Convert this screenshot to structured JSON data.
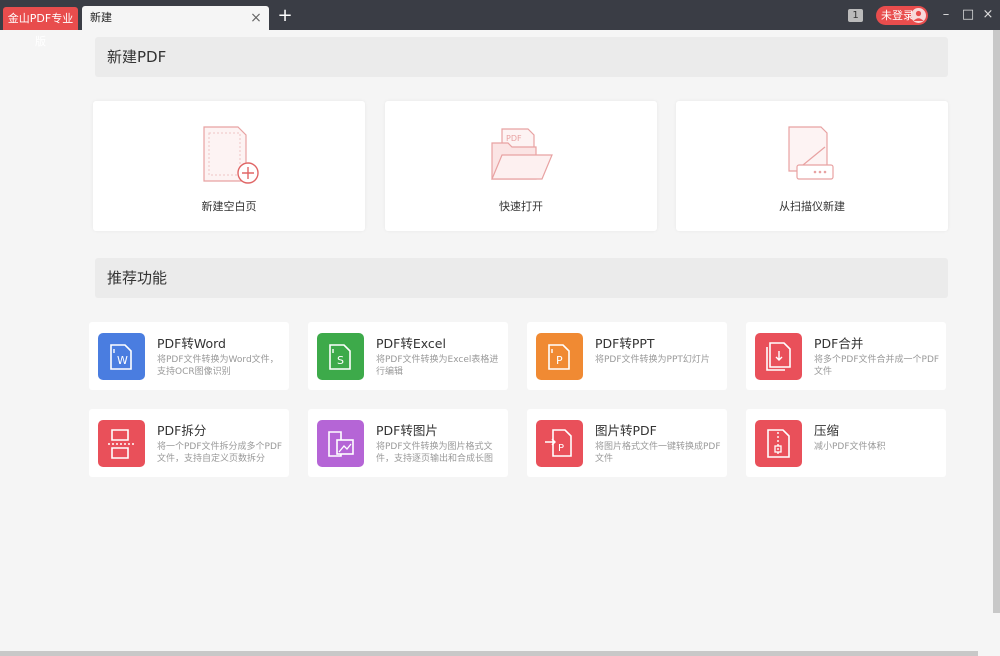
{
  "titlebar": {
    "brand": "金山PDF专业版",
    "tab_title": "新建",
    "close_glyph": "×",
    "new_tab_glyph": "+",
    "badge": "1",
    "login_label": "未登录",
    "minimize_glyph": "–",
    "maximize_glyph": "□",
    "close_window_glyph": "×"
  },
  "new_pdf": {
    "heading": "新建PDF",
    "cards": [
      {
        "label": "新建空白页",
        "icon": "blank-page-plus-icon"
      },
      {
        "label": "快速打开",
        "icon": "open-folder-icon"
      },
      {
        "label": "从扫描仪新建",
        "icon": "scanner-icon"
      }
    ]
  },
  "recommended": {
    "heading": "推荐功能",
    "items": [
      {
        "title": "PDF转Word",
        "desc": "将PDF文件转换为Word文件，支持OCR图像识别",
        "color": "#4a7de0",
        "icon": "word-icon"
      },
      {
        "title": "PDF转Excel",
        "desc": "将PDF文件转换为Excel表格进行编辑",
        "color": "#3daa4a",
        "icon": "excel-icon"
      },
      {
        "title": "PDF转PPT",
        "desc": "将PDF文件转换为PPT幻灯片",
        "color": "#f08a33",
        "icon": "ppt-icon"
      },
      {
        "title": "PDF合并",
        "desc": "将多个PDF文件合并成一个PDF文件",
        "color": "#e9505a",
        "icon": "merge-icon"
      },
      {
        "title": "PDF拆分",
        "desc": "将一个PDF文件拆分成多个PDF文件，支持自定义页数拆分",
        "color": "#e9505a",
        "icon": "split-icon"
      },
      {
        "title": "PDF转图片",
        "desc": "将PDF文件转换为图片格式文件，支持逐页输出和合成长图",
        "color": "#b565d6",
        "icon": "image-icon"
      },
      {
        "title": "图片转PDF",
        "desc": "将图片格式文件一键转换成PDF文件",
        "color": "#e9505a",
        "icon": "image-to-pdf-icon"
      },
      {
        "title": "压缩",
        "desc": "减小PDF文件体积",
        "color": "#e9505a",
        "icon": "compress-icon"
      }
    ]
  }
}
